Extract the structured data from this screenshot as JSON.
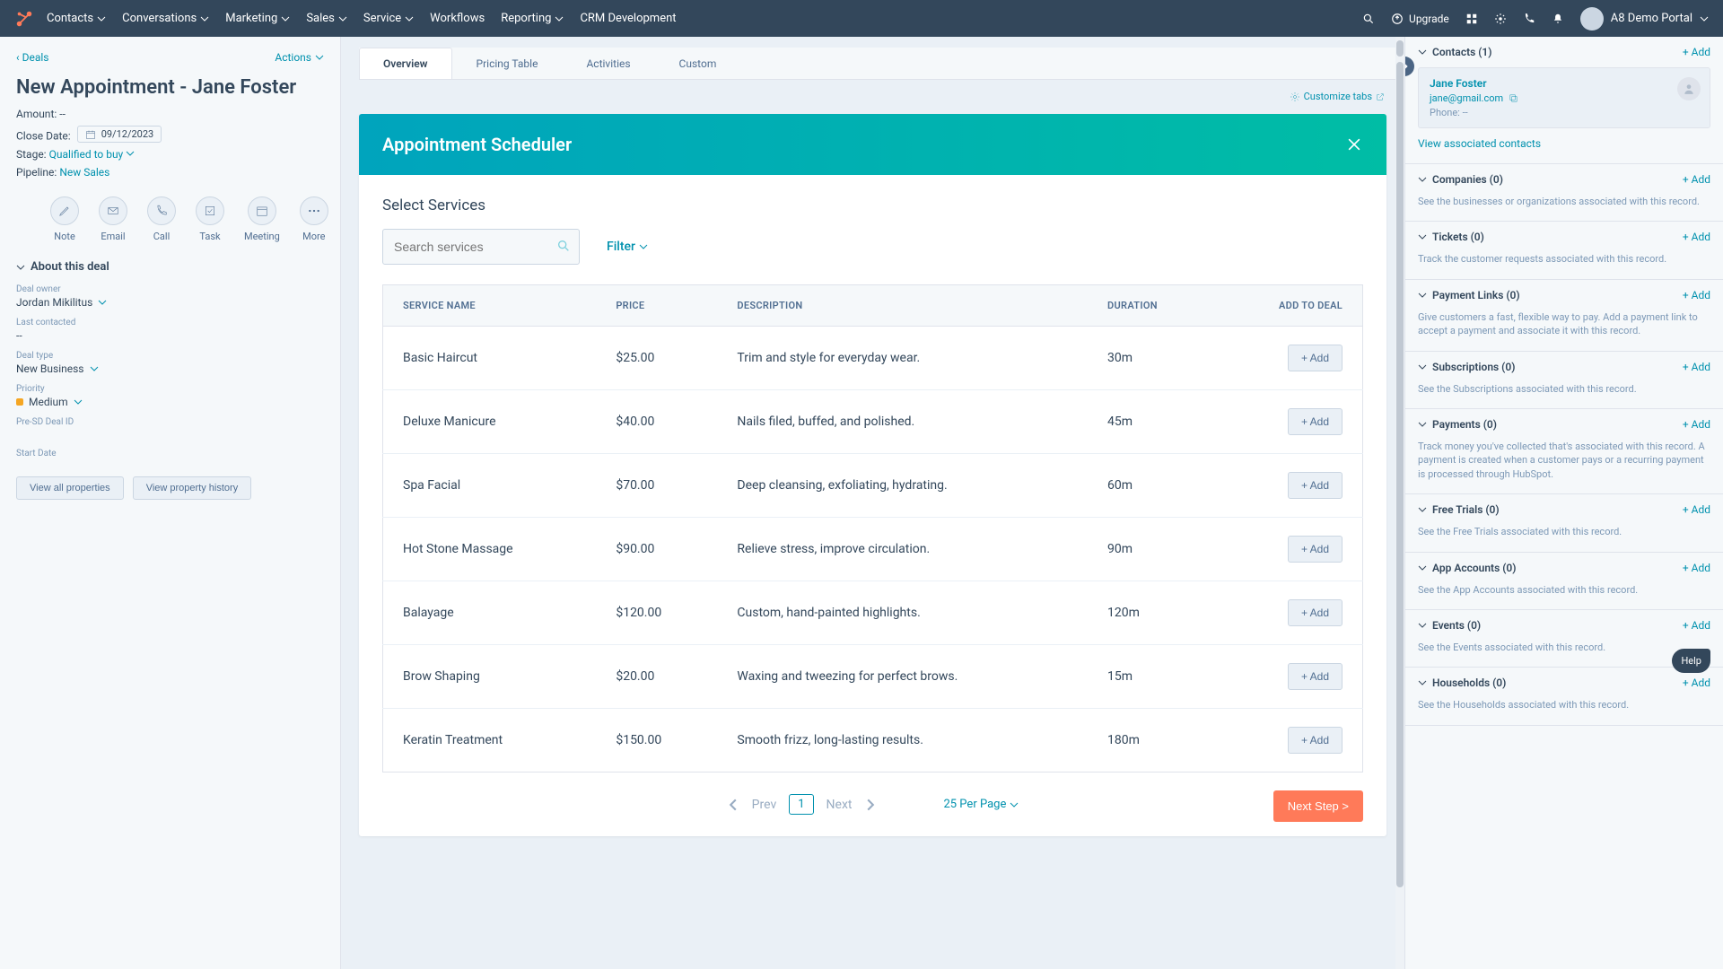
{
  "topnav": {
    "menus": [
      "Contacts",
      "Conversations",
      "Marketing",
      "Sales",
      "Service",
      "Workflows",
      "Reporting",
      "CRM Development"
    ],
    "upgrade": "Upgrade",
    "portal": "A8 Demo Portal"
  },
  "left": {
    "back": "Deals",
    "actions": "Actions",
    "title": "New Appointment - Jane Foster",
    "amount_label": "Amount:",
    "amount": "--",
    "close_label": "Close Date:",
    "close_date": "09/12/2023",
    "stage_label": "Stage:",
    "stage": "Qualified to buy",
    "pipeline_label": "Pipeline:",
    "pipeline": "New Sales",
    "actions_row": [
      "Note",
      "Email",
      "Call",
      "Task",
      "Meeting",
      "More"
    ],
    "about_head": "About this deal",
    "owner_label": "Deal owner",
    "owner": "Jordan Mikilitus",
    "lastcontact_label": "Last contacted",
    "lastcontact": "--",
    "dealtype_label": "Deal type",
    "dealtype": "New Business",
    "priority_label": "Priority",
    "priority": "Medium",
    "presd_label": "Pre-SD Deal ID",
    "startdate_label": "Start Date",
    "viewall": "View all properties",
    "viewhist": "View property history"
  },
  "center": {
    "tabs": [
      "Overview",
      "Pricing Table",
      "Activities",
      "Custom"
    ],
    "customize": "Customize tabs",
    "card_title": "Appointment Scheduler",
    "select_services": "Select Services",
    "search_placeholder": "Search services",
    "filter": "Filter",
    "cols": [
      "SERVICE NAME",
      "PRICE",
      "DESCRIPTION",
      "DURATION",
      "ADD TO DEAL"
    ],
    "rows": [
      {
        "name": "Basic Haircut",
        "price": "$25.00",
        "desc": "Trim and style for everyday wear.",
        "dur": "30m"
      },
      {
        "name": "Deluxe Manicure",
        "price": "$40.00",
        "desc": "Nails filed, buffed, and polished.",
        "dur": "45m"
      },
      {
        "name": "Spa Facial",
        "price": "$70.00",
        "desc": "Deep cleansing, exfoliating, hydrating.",
        "dur": "60m"
      },
      {
        "name": "Hot Stone Massage",
        "price": "$90.00",
        "desc": "Relieve stress, improve circulation.",
        "dur": "90m"
      },
      {
        "name": "Balayage",
        "price": "$120.00",
        "desc": "Custom, hand-painted highlights.",
        "dur": "120m"
      },
      {
        "name": "Brow Shaping",
        "price": "$20.00",
        "desc": "Waxing and tweezing for perfect brows.",
        "dur": "15m"
      },
      {
        "name": "Keratin Treatment",
        "price": "$150.00",
        "desc": "Smooth frizz, long-lasting results.",
        "dur": "180m"
      }
    ],
    "addbtn": "+ Add",
    "prev": "Prev",
    "page": "1",
    "next": "Next",
    "perpage": "25 Per Page",
    "nextstep": "Next Step >"
  },
  "right": {
    "contacts_head": "Contacts (1)",
    "add": "+ Add",
    "contact": {
      "name": "Jane Foster",
      "email": "jane@gmail.com",
      "phone_label": "Phone:",
      "phone": "--"
    },
    "viewassoc": "View associated contacts",
    "sections": [
      {
        "title": "Companies (0)",
        "body": "See the businesses or organizations associated with this record."
      },
      {
        "title": "Tickets (0)",
        "body": "Track the customer requests associated with this record."
      },
      {
        "title": "Payment Links (0)",
        "body": "Give customers a fast, flexible way to pay. Add a payment link to accept a payment and associate it with this record."
      },
      {
        "title": "Subscriptions (0)",
        "body": "See the Subscriptions associated with this record."
      },
      {
        "title": "Payments (0)",
        "body": "Track money you've collected that's associated with this record. A payment is created when a customer pays or a recurring payment is processed through HubSpot."
      },
      {
        "title": "Free Trials (0)",
        "body": "See the Free Trials associated with this record."
      },
      {
        "title": "App Accounts (0)",
        "body": "See the App Accounts associated with this record."
      },
      {
        "title": "Events (0)",
        "body": "See the Events associated with this record."
      },
      {
        "title": "Households (0)",
        "body": "See the Households associated with this record."
      }
    ],
    "help": "Help"
  }
}
